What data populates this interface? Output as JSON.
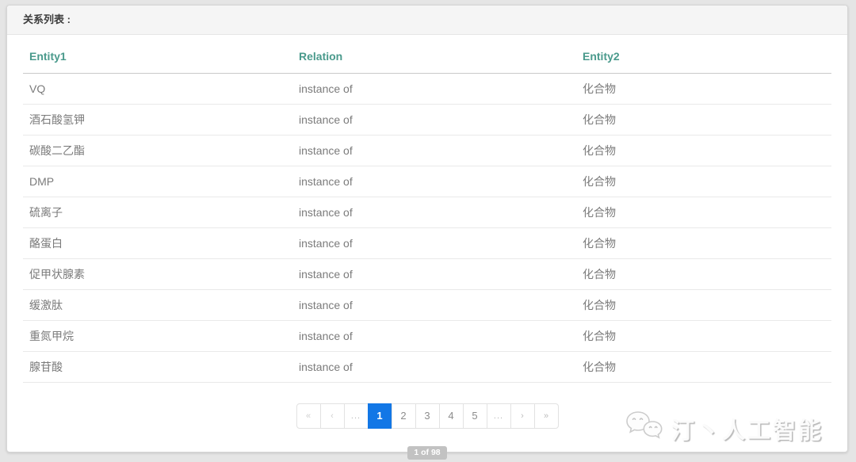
{
  "panel": {
    "title": "关系列表 :"
  },
  "table": {
    "columns": [
      {
        "key": "entity1",
        "label": "Entity1"
      },
      {
        "key": "relation",
        "label": "Relation"
      },
      {
        "key": "entity2",
        "label": "Entity2"
      }
    ],
    "rows": [
      {
        "entity1": "VQ",
        "relation": "instance of",
        "entity2": "化合物"
      },
      {
        "entity1": "酒石酸氢钾",
        "relation": "instance of",
        "entity2": "化合物"
      },
      {
        "entity1": "碳酸二乙酯",
        "relation": "instance of",
        "entity2": "化合物"
      },
      {
        "entity1": "DMP",
        "relation": "instance of",
        "entity2": "化合物"
      },
      {
        "entity1": "硫离子",
        "relation": "instance of",
        "entity2": "化合物"
      },
      {
        "entity1": "酪蛋白",
        "relation": "instance of",
        "entity2": "化合物"
      },
      {
        "entity1": "促甲状腺素",
        "relation": "instance of",
        "entity2": "化合物"
      },
      {
        "entity1": "缓激肽",
        "relation": "instance of",
        "entity2": "化合物"
      },
      {
        "entity1": "重氮甲烷",
        "relation": "instance of",
        "entity2": "化合物"
      },
      {
        "entity1": "腺苷酸",
        "relation": "instance of",
        "entity2": "化合物"
      }
    ]
  },
  "pagination": {
    "items": [
      {
        "label": "«",
        "type": "first",
        "disabled": true
      },
      {
        "label": "‹",
        "type": "prev",
        "disabled": true
      },
      {
        "label": "...",
        "type": "ellipsis"
      },
      {
        "label": "1",
        "type": "page",
        "active": true
      },
      {
        "label": "2",
        "type": "page"
      },
      {
        "label": "3",
        "type": "page"
      },
      {
        "label": "4",
        "type": "page"
      },
      {
        "label": "5",
        "type": "page"
      },
      {
        "label": "...",
        "type": "ellipsis"
      },
      {
        "label": "›",
        "type": "next"
      },
      {
        "label": "»",
        "type": "last"
      }
    ],
    "status": "1 of 98"
  },
  "watermark": {
    "icon": "wechat-icon",
    "text": "汀丶人工智能"
  },
  "colors": {
    "header_accent_teal": "#4a9a8c",
    "active_page_blue": "#1277e6",
    "page_background": "#e5e5e5",
    "status_badge_gray": "#c2c2c2"
  }
}
